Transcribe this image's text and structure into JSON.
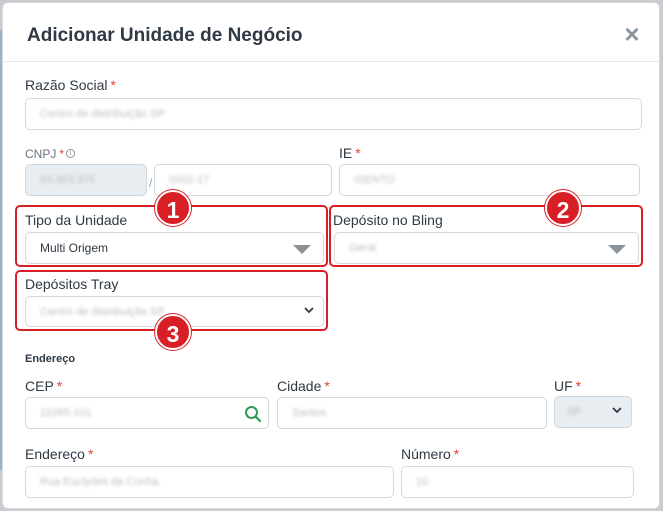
{
  "modal": {
    "title": "Adicionar Unidade de Negócio",
    "close_icon": "close-icon"
  },
  "fields": {
    "razao_social": {
      "label": "Razão Social",
      "required": "*",
      "value": "Centro de distribuição SP"
    },
    "cnpj": {
      "label": "CNPJ",
      "required": "*",
      "info_icon": "info-icon",
      "part1": "63.363.375",
      "separator": "/",
      "part2": "0002-17"
    },
    "ie": {
      "label": "IE",
      "required": "*",
      "value": "ISENTO"
    },
    "tipo_unidade": {
      "label": "Tipo da Unidade",
      "value": "Multi Origem"
    },
    "deposito_bling": {
      "label": "Depósito no Bling",
      "value": "Geral"
    },
    "depositos_tray": {
      "label": "Depósitos Tray",
      "value": "Centro de distribuição SP"
    }
  },
  "address": {
    "section_title": "Endereço",
    "cep": {
      "label": "CEP",
      "required": "*",
      "value": "11065-101",
      "icon": "search-icon"
    },
    "cidade": {
      "label": "Cidade",
      "required": "*",
      "value": "Santos"
    },
    "uf": {
      "label": "UF",
      "required": "*",
      "value": "SP"
    },
    "endereco": {
      "label": "Endereço",
      "required": "*",
      "value": "Rua Euclydes da Cunha"
    },
    "numero": {
      "label": "Número",
      "required": "*",
      "value": "10"
    }
  },
  "annotations": {
    "badge1": "1",
    "badge2": "2",
    "badge3": "3",
    "color": "#d81f26"
  }
}
